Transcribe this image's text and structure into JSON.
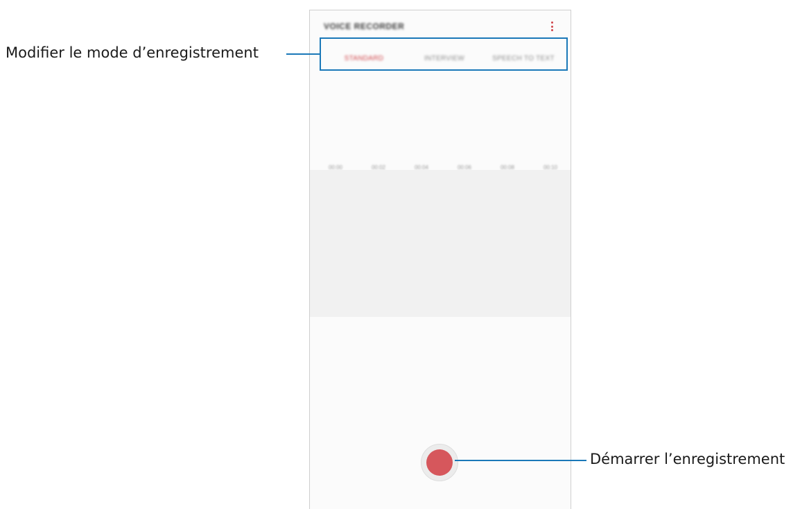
{
  "app": {
    "title": "VOICE RECORDER",
    "menu_icon": "more-vertical-icon"
  },
  "tabs": [
    {
      "label": "STANDARD",
      "active": true
    },
    {
      "label": "INTERVIEW",
      "active": false
    },
    {
      "label": "SPEECH TO TEXT",
      "active": false
    }
  ],
  "timeline": {
    "labels": [
      "00:00",
      "00:02",
      "00:04",
      "00:06",
      "00:08",
      "00:10"
    ]
  },
  "record_button": {
    "icon": "record-icon"
  },
  "callouts": {
    "mode": "Modifier le mode d’enregistrement",
    "record": "Démarrer l’enregistrement"
  },
  "colors": {
    "accent": "#d0454a",
    "callout": "#1a78b8",
    "record": "#d6575c"
  }
}
